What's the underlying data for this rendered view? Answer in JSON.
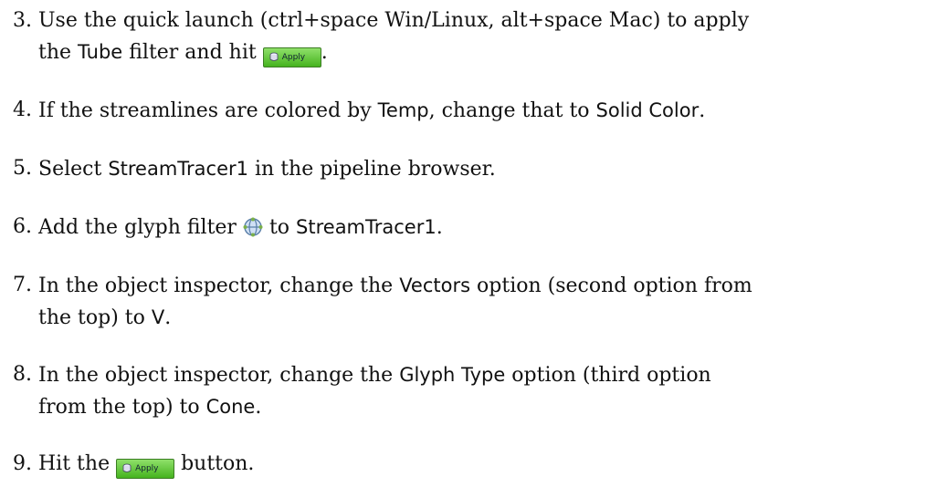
{
  "items": [
    {
      "num": "3.",
      "line1_pre": "Use the quick launch (ctrl+space Win/Linux, alt+space Mac) to apply",
      "line2_pre": "the ",
      "filter": "Tube",
      "line2_mid": " filter and hit ",
      "apply_label": "Apply",
      "line2_post": "."
    },
    {
      "num": "4.",
      "pre": "If the streamlines are colored by ",
      "term1": "Temp",
      "mid": ", change that to ",
      "term2": "Solid Color",
      "post": "."
    },
    {
      "num": "5.",
      "pre": "Select ",
      "term": "StreamTracer1",
      "post": " in the pipeline browser."
    },
    {
      "num": "6.",
      "pre": "Add the glyph filter ",
      "mid": " to ",
      "term": "StreamTracer1",
      "post": "."
    },
    {
      "num": "7.",
      "pre": "In the object inspector, change the ",
      "term1": "Vectors",
      "line1_post": " option (second option from",
      "line2_pre": "the top) to ",
      "term2": "V",
      "line2_post": "."
    },
    {
      "num": "8.",
      "pre": "In the object inspector, change the ",
      "term1": "Glyph Type",
      "line1_post": " option (third option",
      "line2_pre": "from the top) to ",
      "term2": "Cone",
      "line2_post": "."
    },
    {
      "num": "9.",
      "pre": "Hit the ",
      "apply_label": "Apply",
      "post": " button."
    }
  ],
  "icons": {
    "apply": "apply-icon",
    "glyph": "glyph-filter-icon"
  },
  "colors": {
    "apply_button_top": "#8fe06a",
    "apply_button_bottom": "#45b31e"
  }
}
